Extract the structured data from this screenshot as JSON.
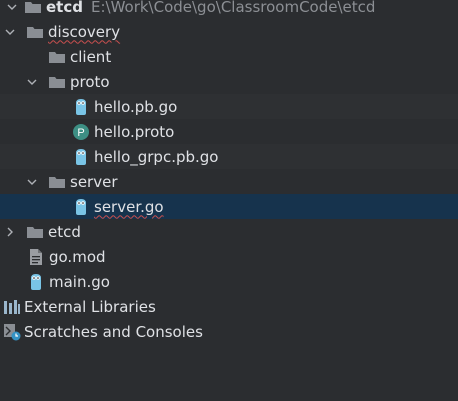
{
  "project": {
    "name": "etcd",
    "path": "E:\\Work\\Code\\go\\ClassroomCode\\etcd"
  },
  "tree": {
    "discovery": "discovery",
    "client": "client",
    "proto": "proto",
    "hello_pb": "hello.pb.go",
    "hello_proto": "hello.proto",
    "hello_grpc": "hello_grpc.pb.go",
    "server": "server",
    "server_go": "server.go",
    "etcd": "etcd",
    "go_mod": "go.mod",
    "main_go": "main.go",
    "external_libraries": "External Libraries",
    "scratches": "Scratches and Consoles"
  },
  "icons": {
    "proto_file": "P"
  },
  "colors": {
    "background": "#2b2d30",
    "selection": "#16334d",
    "text": "#dfe1e5",
    "path_text": "#8c8f94"
  }
}
